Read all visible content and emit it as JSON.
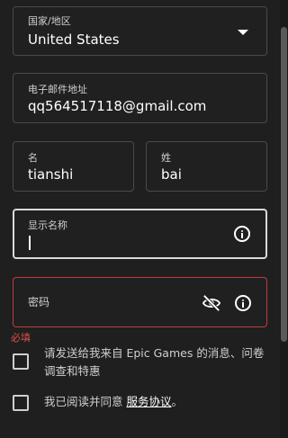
{
  "form": {
    "country": {
      "label": "国家/地区",
      "value": "United States"
    },
    "email": {
      "label": "电子邮件地址",
      "value": "qq564517118@gmail.com"
    },
    "first_name": {
      "label": "名",
      "value": "tianshi"
    },
    "last_name": {
      "label": "姓",
      "value": "bai"
    },
    "display_name": {
      "label": "显示名称",
      "value": ""
    },
    "password": {
      "label": "密码",
      "value": ""
    },
    "password_error": "必填",
    "promo_checkbox": {
      "text": "请发送给我来自 Epic Games 的消息、问卷调查和特惠",
      "checked": false
    },
    "terms_checkbox": {
      "prefix": "我已阅读并同意 ",
      "link": "服务协议",
      "suffix": "。",
      "checked": false
    }
  },
  "colors": {
    "background": "#1f1f1f",
    "border": "#4a4a4a",
    "focus_border": "#d9d9d9",
    "error": "#e04b4b"
  },
  "icons": {
    "country_dropdown": "chevron-down-icon",
    "display_name_info": "info-icon",
    "password_visibility": "eye-off-icon",
    "password_info": "info-icon"
  }
}
